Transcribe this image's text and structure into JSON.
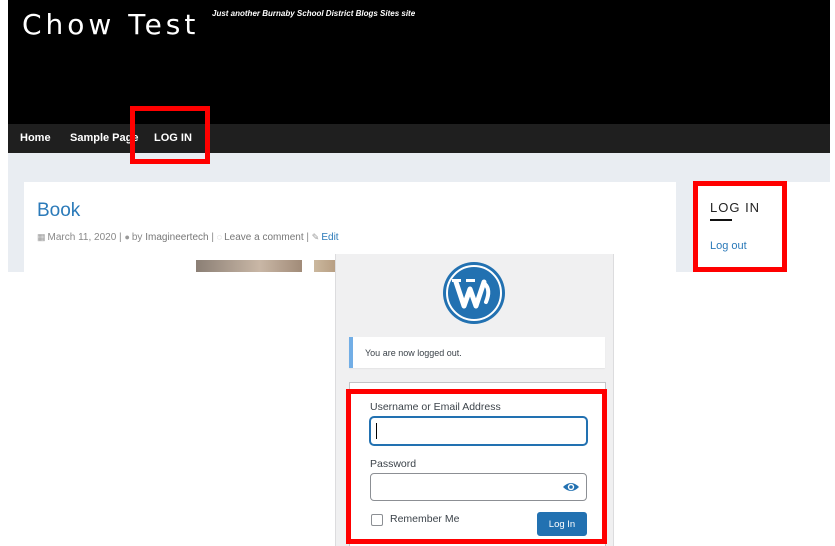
{
  "site": {
    "title": "Chow Test",
    "tagline": "Just another Burnaby School District Blogs Sites site",
    "nav": {
      "home": "Home",
      "sample_page": "Sample Page",
      "login": "LOG IN"
    },
    "post": {
      "title": "Book",
      "date": "March 11, 2020",
      "separator": "|",
      "author_prefix": "by",
      "author": "Imagineertech",
      "comment_link": "Leave a comment",
      "edit_link": "Edit"
    },
    "sidebar": {
      "widget_title": "LOG IN",
      "logout_link": "Log out"
    }
  },
  "login_screen": {
    "notice": "You are now logged out.",
    "username_label": "Username or Email Address",
    "username_value": "",
    "password_label": "Password",
    "password_value": "",
    "remember_label": "Remember Me",
    "submit_label": "Log In"
  },
  "colors": {
    "link_blue": "#2b7ab9",
    "wp_primary": "#2271b1",
    "notice_border": "#72aee6",
    "highlight_red": "#ff0000",
    "header_black": "#000000",
    "nav_dark": "#1f1f1f"
  },
  "icons": {
    "calendar": "calendar-icon",
    "user": "user-icon",
    "comment": "comment-icon",
    "edit": "edit-icon",
    "logo": "wordpress-logo-icon",
    "show_password": "eye-icon"
  }
}
